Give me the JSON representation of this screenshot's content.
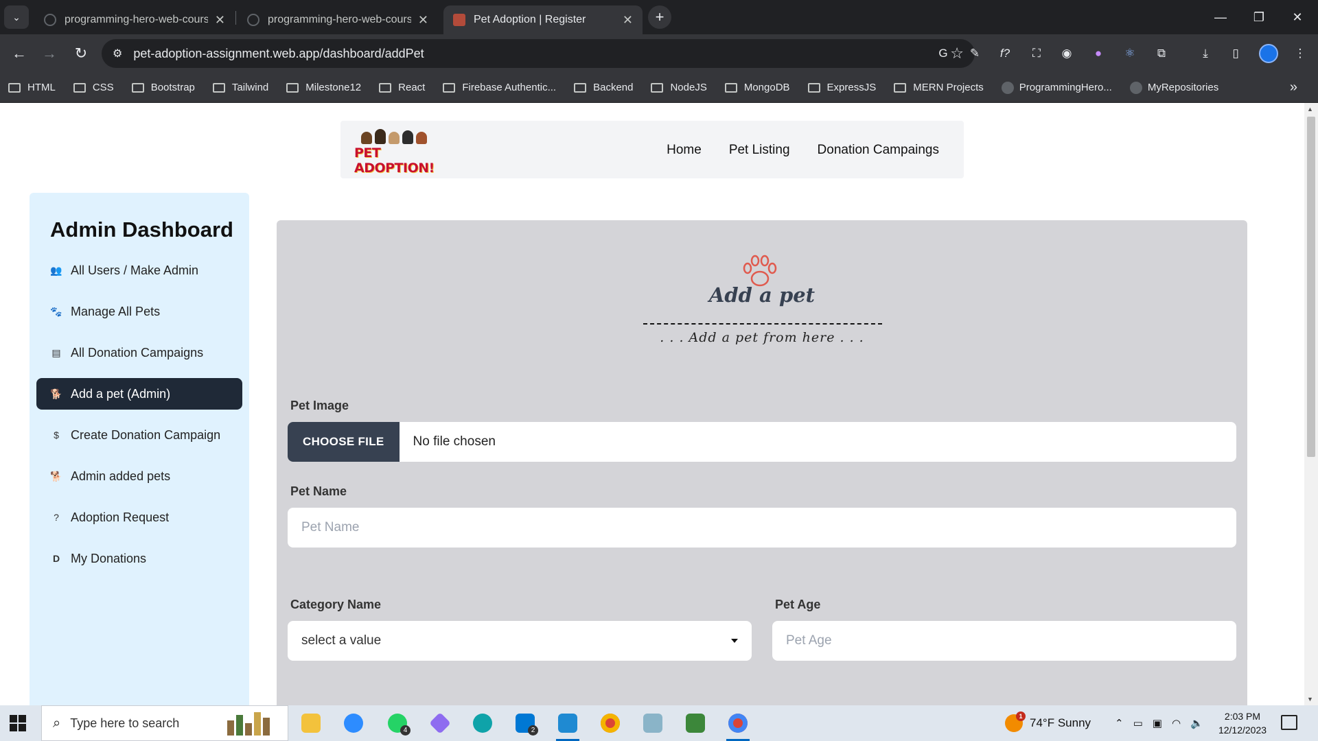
{
  "browser": {
    "tabs": [
      {
        "title": "programming-hero-web-cours",
        "active": false
      },
      {
        "title": "programming-hero-web-cours",
        "active": false
      },
      {
        "title": "Pet Adoption | Register",
        "active": true
      }
    ],
    "url": "pet-adoption-assignment.web.app/dashboard/addPet",
    "bookmarks": [
      "HTML",
      "CSS",
      "Bootstrap",
      "Tailwind",
      "Milestone12",
      "React",
      "Firebase Authentic...",
      "Backend",
      "NodeJS",
      "MongoDB",
      "ExpressJS",
      "MERN Projects",
      "ProgrammingHero...",
      "MyRepositories"
    ],
    "extension_icons": [
      "google-translate-icon",
      "extension-icon",
      "fx-icon",
      "screenshot-icon",
      "camera-icon",
      "palette-icon",
      "react-devtools-icon",
      "puzzle-icon"
    ]
  },
  "navbar": {
    "logo_text": "PET ADOPTION!",
    "links": [
      "Home",
      "Pet Listing",
      "Donation Campaings"
    ]
  },
  "sidebar": {
    "title": "Admin Dashboard",
    "items": [
      {
        "label": "All Users / Make Admin",
        "icon": "users-icon",
        "active": false
      },
      {
        "label": "Manage All Pets",
        "icon": "paw-icon",
        "active": false
      },
      {
        "label": "All Donation Campaigns",
        "icon": "campaign-icon",
        "active": false
      },
      {
        "label": "Add a pet (Admin)",
        "icon": "dog-icon",
        "active": true
      },
      {
        "label": "Create Donation Campaign",
        "icon": "donation-icon",
        "active": false
      },
      {
        "label": "Admin added pets",
        "icon": "dog-icon",
        "active": false
      },
      {
        "label": "Adoption Request",
        "icon": "question-circle-icon",
        "active": false
      },
      {
        "label": "My Donations",
        "icon": "d-letter-icon",
        "active": false
      }
    ]
  },
  "form": {
    "title": "Add a pet",
    "subtitle": ". . . Add a pet from here . . .",
    "pet_image_label": "Pet Image",
    "choose_file_label": "CHOOSE FILE",
    "file_status": "No file chosen",
    "pet_name_label": "Pet Name",
    "pet_name_placeholder": "Pet Name",
    "category_label": "Category Name",
    "category_value": "select a value",
    "pet_age_label": "Pet Age",
    "pet_age_placeholder": "Pet Age"
  },
  "taskbar": {
    "search_placeholder": "Type here to search",
    "weather": "74°F  Sunny",
    "weather_badge": "1",
    "time": "2:03 PM",
    "date": "12/12/2023",
    "whatsapp_badge": "4",
    "mail_badge": "2"
  },
  "colors": {
    "active_sidebar": "#1f2937",
    "sidebar_bg": "#e0f2fe",
    "form_bg": "#d4d4d8",
    "paw": "#e05a4e"
  }
}
